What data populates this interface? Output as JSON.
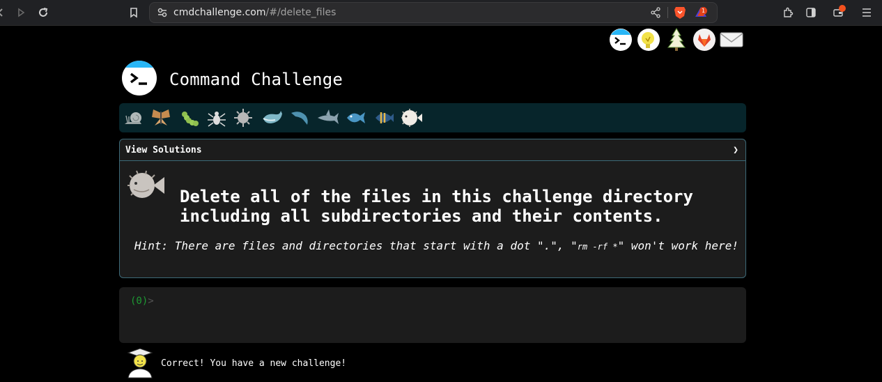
{
  "browser": {
    "url_host": "cmdchallenge.com",
    "url_path": "/#/delete_files",
    "rewards_badge": "1"
  },
  "header": {
    "title": "Command Challenge",
    "top_icons": [
      "terminal-icon",
      "lightbulb-icon",
      "tree-icon",
      "gitlab-icon",
      "mail-icon"
    ]
  },
  "levels": [
    "snail-icon",
    "butterfly-icon",
    "caterpillar-icon",
    "spider-icon",
    "virus-icon",
    "whale-icon",
    "dolphin-icon",
    "shark-icon",
    "fish-icon",
    "angelfish-icon",
    "blowfish-icon"
  ],
  "challenge": {
    "view_solutions_label": "View Solutions",
    "chevron": "❯",
    "text": "Delete all of the files in this challenge directory including all subdirectories and their contents.",
    "hint_prefix": "Hint: There are files and directories that start with a dot \".\", \"",
    "hint_code": "rm -rf *",
    "hint_suffix": "\" won't work here!"
  },
  "terminal": {
    "prompt_count": "(0)",
    "prompt_symbol": ">",
    "input_value": ""
  },
  "status": {
    "message": "Correct! You have a new challenge!"
  },
  "colors": {
    "level_bar_bg": "#07252b",
    "box_border": "#3d6a78",
    "prompt_green": "#1d9a33",
    "accent_blue": "#29b6f6"
  }
}
